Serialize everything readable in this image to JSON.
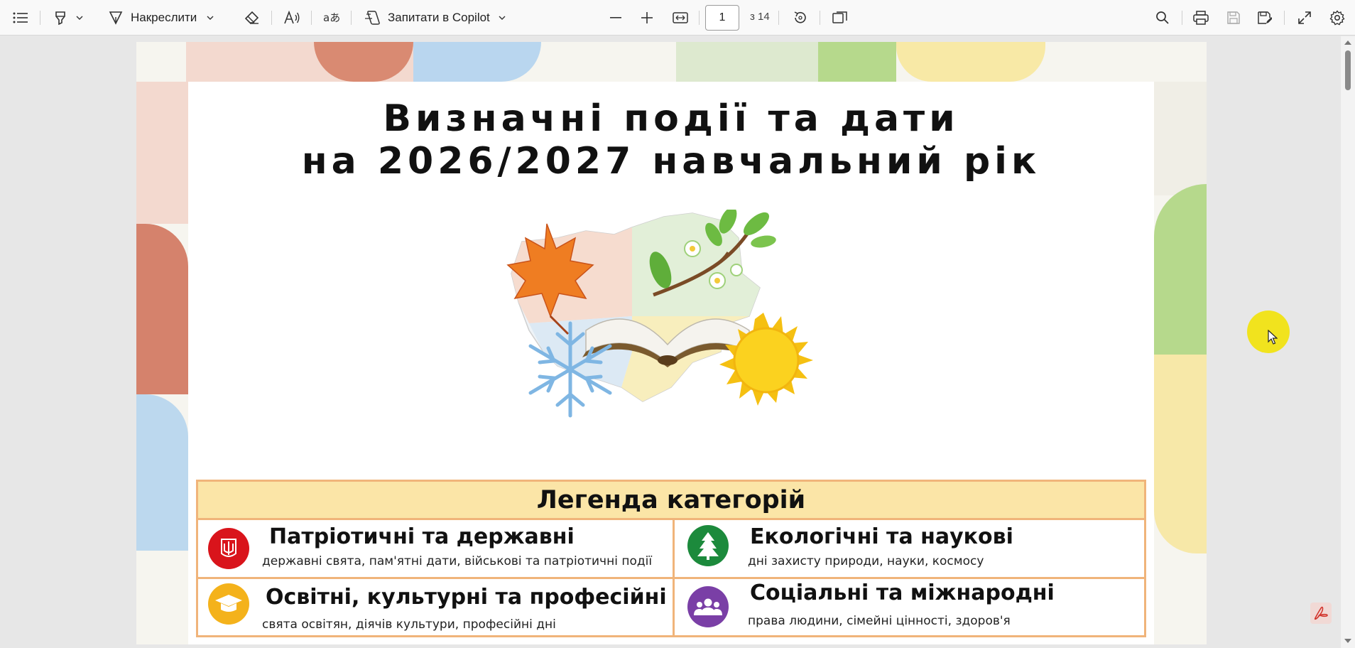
{
  "toolbar": {
    "contents_icon": "list-icon",
    "highlight_icon": "highlighter-icon",
    "draw_label": "Накреслити",
    "erase_icon": "eraser-icon",
    "read_aloud_icon": "read-aloud-icon",
    "translate_icon": "translate-icon",
    "copilot_label": "Запитати в Copilot",
    "zoom_out_icon": "minus-icon",
    "zoom_in_icon": "plus-icon",
    "fit_icon": "fit-width-icon",
    "page_current": "1",
    "page_total": "з 14",
    "rotate_icon": "rotate-icon",
    "page_view_icon": "page-view-icon",
    "search_icon": "search-icon",
    "print_icon": "print-icon",
    "save_icon": "save-icon",
    "save_as_icon": "save-as-icon",
    "fullscreen_icon": "expand-icon",
    "settings_icon": "gear-icon"
  },
  "document": {
    "title_line1": "Визначні події та дати",
    "title_line2": "на 2026/2027 навчальний рік",
    "legend": {
      "heading": "Легенда категорій",
      "categories": [
        {
          "title": "Патріотичні та державні",
          "desc": "державні свята, пам'ятні дати, військові та патріотичні події",
          "color": "#d9141b",
          "icon": "trident-icon"
        },
        {
          "title": "Екологічні та наукові",
          "desc": "дні захисту природи, науки, космосу",
          "color": "#1c8a3c",
          "icon": "tree-icon"
        },
        {
          "title": "Освітні, культурні та професійні",
          "desc": "свята освітян, діячів культури, професійні дні",
          "color": "#f4b21b",
          "icon": "graduation-cap-icon"
        },
        {
          "title": "Соціальні та міжнародні",
          "desc": "права людини, сімейні цінності, здоров'я",
          "color": "#7a3fa6",
          "icon": "people-icon"
        }
      ]
    }
  },
  "colors": {
    "legend_border": "#f0b47a",
    "legend_header": "#fbe5a7",
    "cursor_highlight": "#f1e31e"
  }
}
